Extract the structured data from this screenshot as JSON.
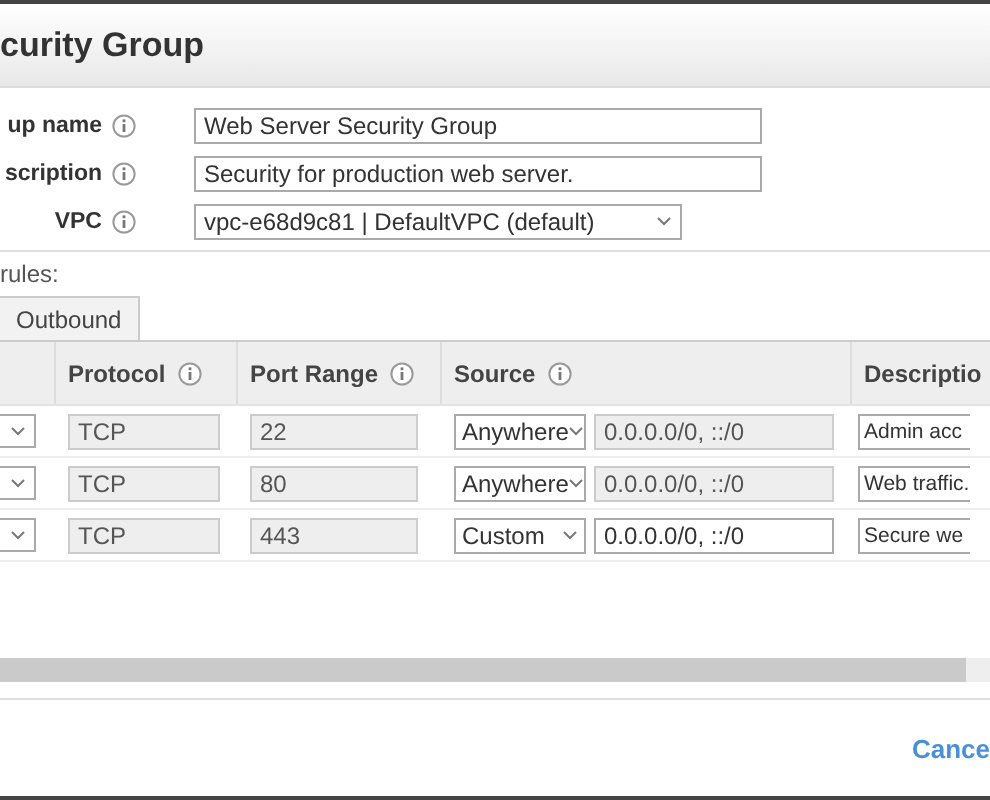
{
  "dialog": {
    "title": "curity Group"
  },
  "fields": [
    {
      "label": "up name",
      "kind": "text",
      "value": "Web Server Security Group"
    },
    {
      "label": "scription",
      "kind": "text",
      "value": "Security for production web server."
    },
    {
      "label": "VPC",
      "kind": "select",
      "value": "vpc-e68d9c81 | DefaultVPC (default)"
    }
  ],
  "rules_label": "rules:",
  "tabs": [
    {
      "label": "Outbound",
      "selected": false
    }
  ],
  "table": {
    "columns": [
      {
        "label": "Protocol"
      },
      {
        "label": "Port Range"
      },
      {
        "label": "Source"
      },
      {
        "label": "Descriptio"
      }
    ],
    "rows": [
      {
        "protocol": "TCP",
        "port_range": "22",
        "source": "Anywhere",
        "cidr": "0.0.0.0/0, ::/0",
        "cidr_disabled": true,
        "description": "Admin acc"
      },
      {
        "protocol": "TCP",
        "port_range": "80",
        "source": "Anywhere",
        "cidr": "0.0.0.0/0, ::/0",
        "cidr_disabled": true,
        "description": "Web traffic."
      },
      {
        "protocol": "TCP",
        "port_range": "443",
        "source": "Custom",
        "cidr": "0.0.0.0/0, ::/0",
        "cidr_disabled": false,
        "description": "Secure we"
      }
    ]
  },
  "footer": {
    "cancel": "Cance"
  }
}
